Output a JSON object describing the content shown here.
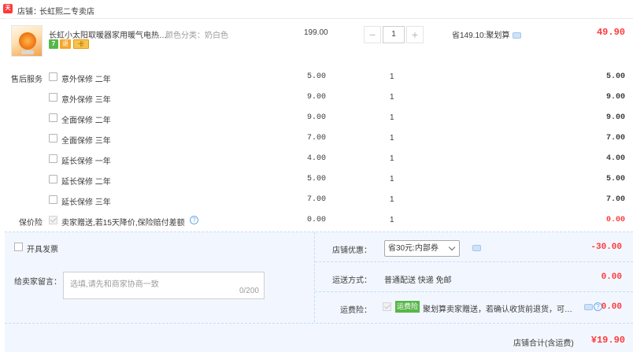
{
  "shop": {
    "logo_text": "天猫",
    "label": "店铺：",
    "name": "长虹熙二专卖店"
  },
  "product": {
    "title": "长虹小太阳取暖器家用暖气电热…",
    "spec": "颜色分类：奶白色",
    "badges": [
      "7",
      "退",
      "卡"
    ],
    "unit_price": "199.00",
    "quantity": "1",
    "savings": "省149.10:聚划算",
    "total": "49.90"
  },
  "services": {
    "label": "售后服务",
    "items": [
      {
        "name": "意外保修 二年",
        "price": "5.00",
        "qty": "1",
        "total": "5.00"
      },
      {
        "name": "意外保修 三年",
        "price": "9.00",
        "qty": "1",
        "total": "9.00"
      },
      {
        "name": "全面保修 二年",
        "price": "9.00",
        "qty": "1",
        "total": "9.00"
      },
      {
        "name": "全面保修 三年",
        "price": "7.00",
        "qty": "1",
        "total": "7.00"
      },
      {
        "name": "延长保修 一年",
        "price": "4.00",
        "qty": "1",
        "total": "4.00"
      },
      {
        "name": "延长保修 二年",
        "price": "5.00",
        "qty": "1",
        "total": "5.00"
      },
      {
        "name": "延长保修 三年",
        "price": "7.00",
        "qty": "1",
        "total": "7.00"
      }
    ]
  },
  "price_protection": {
    "label": "保价险",
    "name": "卖家赠送,若15天降价,保险赔付差额",
    "price": "0.00",
    "qty": "1",
    "total": "0.00"
  },
  "invoice": {
    "label": "开具发票"
  },
  "message": {
    "label": "给卖家留言：",
    "placeholder": "选填,请先和商家协商一致",
    "counter": "0/200"
  },
  "discount": {
    "label": "店铺优惠：",
    "selected": "省30元:内部券",
    "value": "-30.00"
  },
  "shipping": {
    "label": "运送方式：",
    "value": "普通配送 快递 免邮",
    "cost": "0.00"
  },
  "freight_insurance": {
    "label": "运费险：",
    "tag": "运费险",
    "text": "聚划算卖家赠送，若确认收货前退货，可获…",
    "cost": "0.00"
  },
  "total": {
    "label": "店铺合计(含运费)",
    "value": "¥19.90"
  },
  "colors": {
    "accent_red": "#ff3a3a",
    "panel_bg": "#f2f7ff",
    "tag_green": "#58b64a"
  }
}
